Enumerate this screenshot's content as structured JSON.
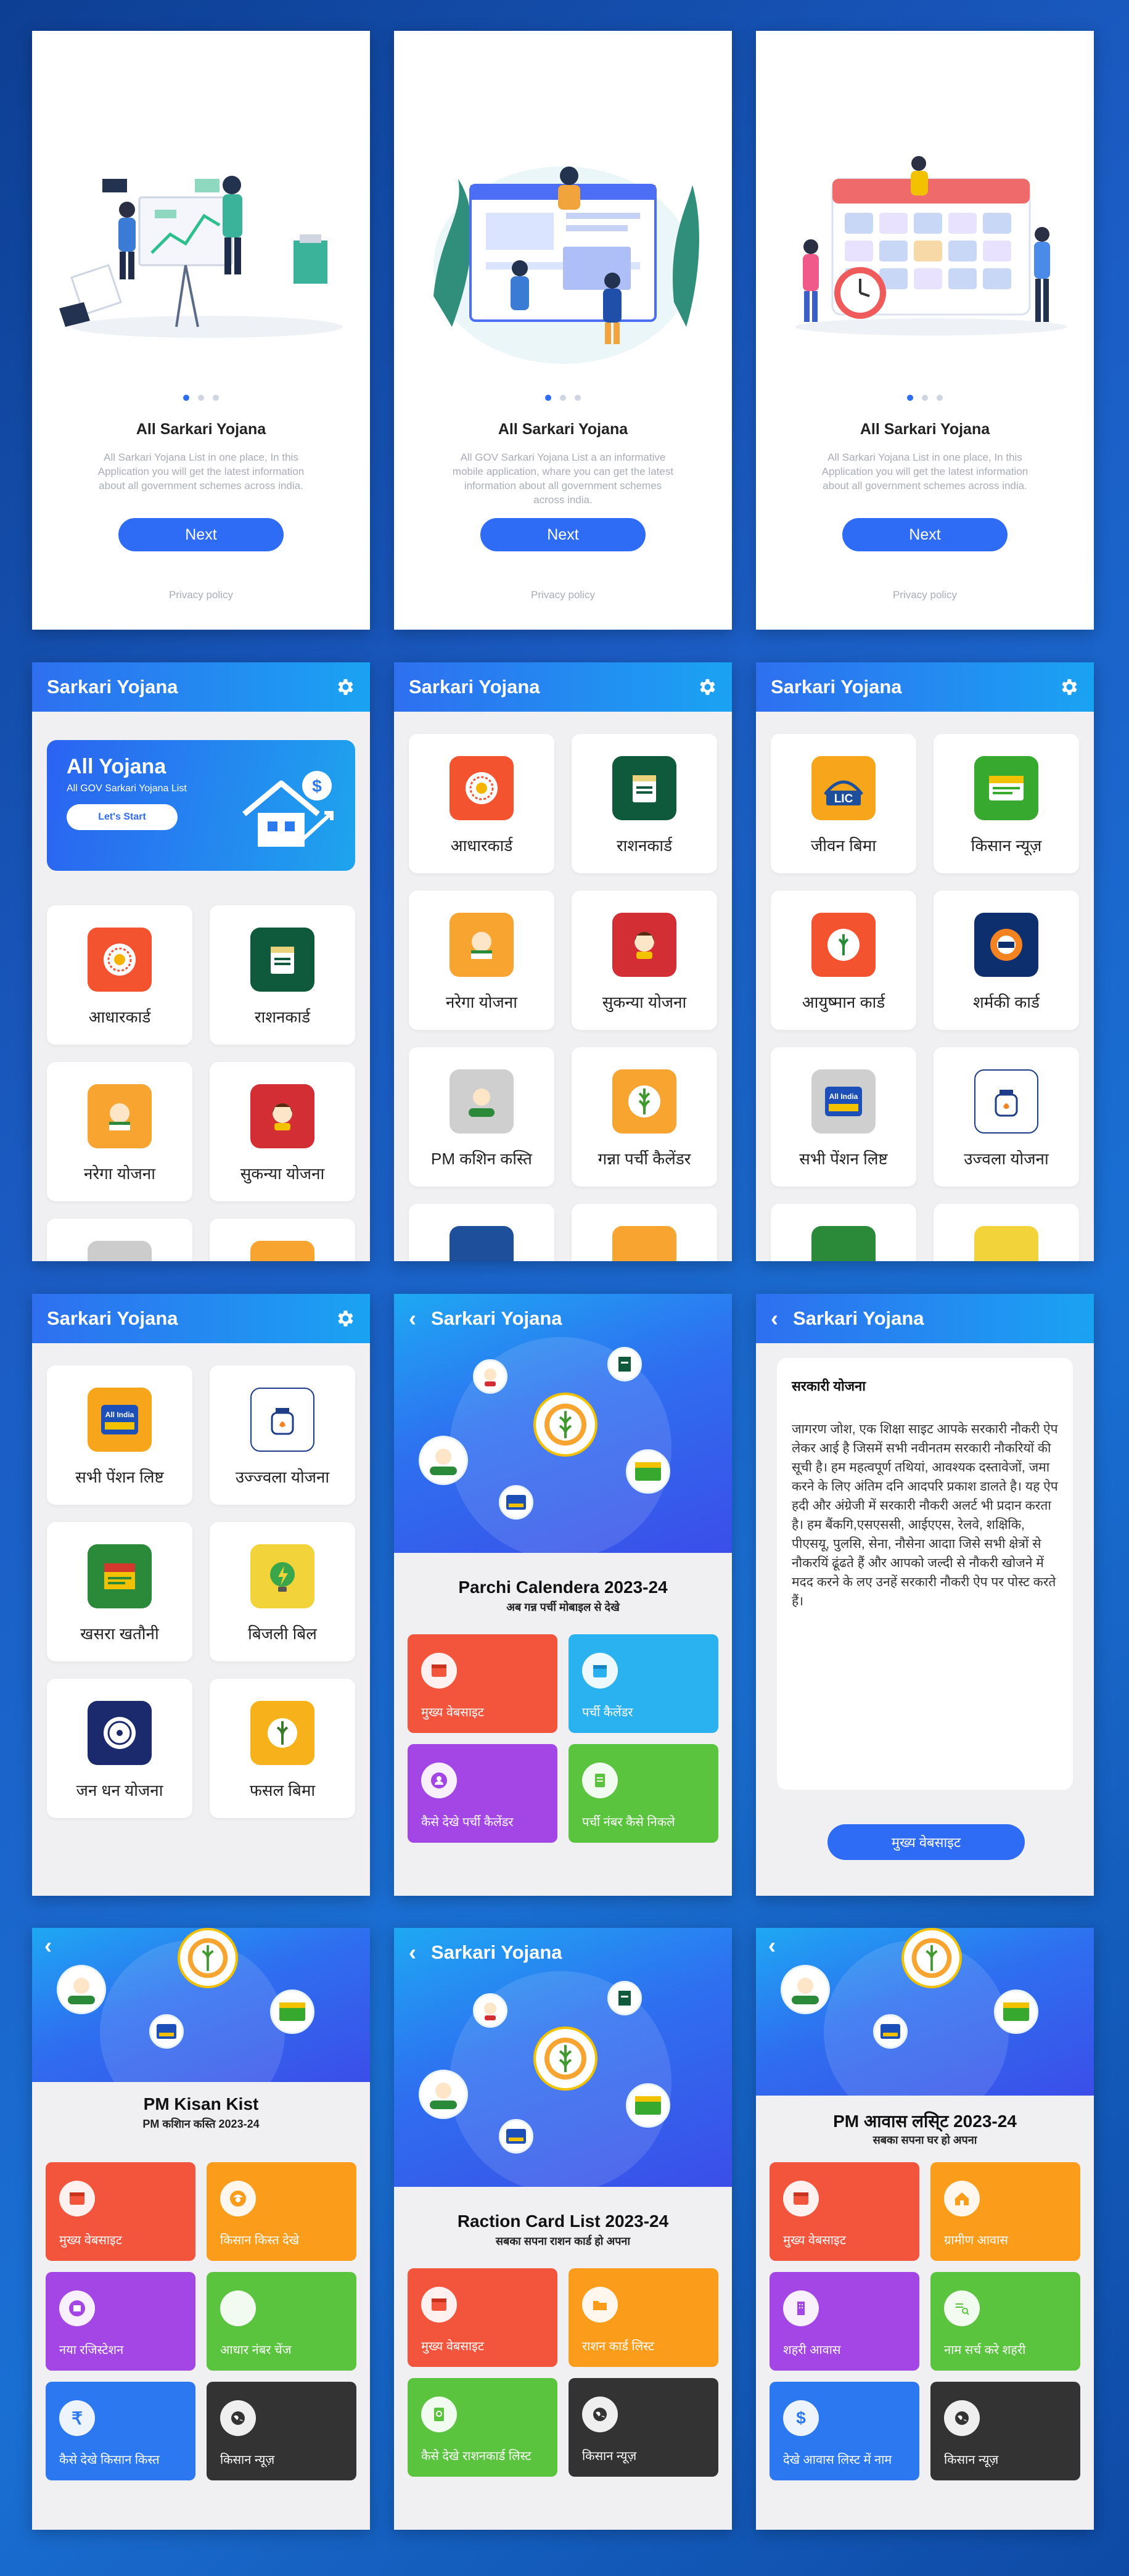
{
  "onboarding": [
    {
      "title": "All Sarkari Yojana",
      "desc": "All Sarkari Yojana List in one place, In this Application you will get the latest information about all government schemes across india.",
      "next": "Next",
      "privacy": "Privacy policy"
    },
    {
      "title": "All Sarkari Yojana",
      "desc": "All GOV Sarkari Yojana List a an informative mobile application, whare you can get the latest information about all government schemes across india.",
      "next": "Next",
      "privacy": "Privacy policy"
    },
    {
      "title": "All Sarkari Yojana",
      "desc": "All Sarkari Yojana List in one place, In this Application you will get the latest information about all government schemes across india.",
      "next": "Next",
      "privacy": "Privacy policy"
    }
  ],
  "app_title": "Sarkari Yojana",
  "home": {
    "banner_title": "All Yojana",
    "banner_sub": "All GOV Sarkari Yojana List",
    "banner_btn": "Let's Start",
    "tiles": [
      "आधारकार्ड",
      "राशनकार्ड",
      "नरेगा योजना",
      "सुकन्या योजना"
    ]
  },
  "list2": {
    "tiles": [
      "आधारकार्ड",
      "राशनकार्ड",
      "नरेगा योजना",
      "सुकन्या योजना",
      "PM कशिन कस्ति",
      "गन्ना पर्ची कैलेंडर"
    ]
  },
  "list3": {
    "tiles": [
      "जीवन बिमा",
      "किसान न्यूज़",
      "आयुष्मान कार्ड",
      "शर्मकी कार्ड",
      "सभी पेंशन लिष्ट",
      "उज्वला योजना"
    ]
  },
  "list4": {
    "tiles": [
      "सभी पेंशन लिष्ट",
      "उज्ज्वला योजना",
      "खसरा खतौनी",
      "बिजली बिल",
      "जन धन योजना",
      "फसल बिमा"
    ]
  },
  "parchi": {
    "title": "Parchi Calendera 2023-24",
    "sub": "अब गन्न पर्ची मोबाइल से देखे",
    "cards": [
      "मुख्य वेबसाइट",
      "पर्ची कैलेंडर",
      "कैसे देखे पर्ची कैलेंडर",
      "पर्ची नंबर कैसे निकले"
    ]
  },
  "article": {
    "heading": "सरकारी योजना",
    "body": "जागरण जोश, एक शिक्षा साइट आपके सरकारी नौकरी ऐप लेकर आई है जिसमें सभी नवीनतम सरकारी नौकरियों की सूची है। हम महत्वपूर्ण तथियां, आवश्यक दस्तावेजों, जमा करने के लिए अंतिम दनि आदपरि प्रकाश डालते है। यह  ऐप हदी और अंग्रेजी में सरकारी नौकरी अलर्ट भी प्रदान करता है। हम बैंकगि,एसएससी, आईएएस, रेलवे, शक्षिकि, पीएसयू, पुलसि, सेना, नौसेना आदाा जिसे सभी क्षेत्रों से नौकरयिं ढूंढते हैं और आपको जल्दी से नौकरी खोजने में मदद करने के लए उनहें सरकारी नौकरी ऐप पर पोस्ट करते हैं।",
    "btn": "मुख्य वेबसाइट"
  },
  "pmkisan": {
    "title": "PM Kisan Kist",
    "sub": "PM कशिान कस्ति 2023-24",
    "cards": [
      "मुख्य वेबसाइट",
      "किसान किस्त देखे",
      "नया रजिस्टेशन",
      "आधार नंबर चेंज",
      "कैसे देखे किसान किस्त",
      "किसान न्यूज़"
    ]
  },
  "ration": {
    "title": "Raction Card List 2023-24",
    "sub": "सबका सपना राशन कार्ड हो अपना",
    "cards": [
      "मुख्य वेबसाइट",
      "राशन कार्ड लिस्ट",
      "कैसे देखे राशनकार्ड लिस्ट",
      "किसान न्यूज़"
    ]
  },
  "awas": {
    "title": "PM आवास लसि्ट 2023-24",
    "sub": "सबका सपना घर हो अपना",
    "cards": [
      "मुख्य वेबसाइट",
      "ग्रामीण आवास",
      "शहरी आवास",
      "नाम सर्च करे शहरी",
      "देखे आवास लिस्ट में नाम",
      "किसान न्यूज़"
    ]
  },
  "colors": {
    "primary": "#2e6cf5",
    "bar_start": "#2e6ff0",
    "bar_end": "#1aa3f2"
  }
}
